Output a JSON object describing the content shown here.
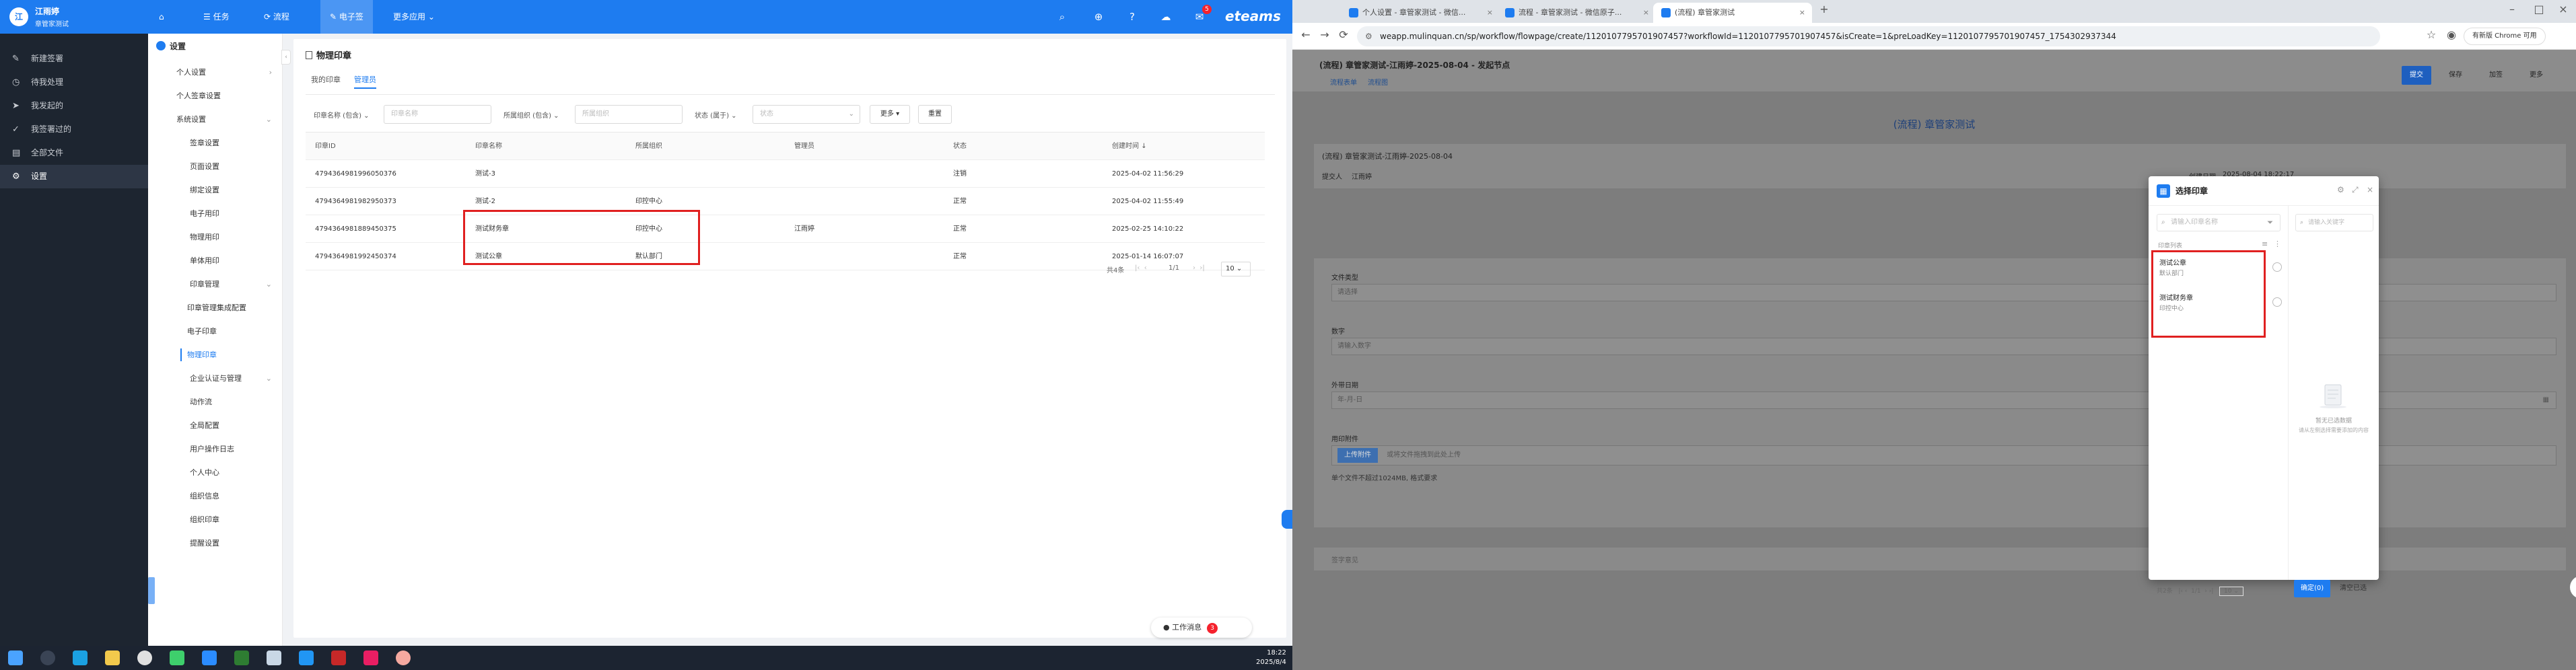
{
  "topbar": {
    "avatar_letter": "江",
    "user_name": "江雨婷",
    "user_sub": "章管家测试",
    "nav": [
      "首页",
      "任务",
      "流程",
      "电子签",
      "更多应用"
    ],
    "badge_count": "5",
    "logo": "eteams"
  },
  "sidebar": {
    "items": [
      "新建签署",
      "待我处理",
      "我发起的",
      "我签署过的",
      "全部文件",
      "设置"
    ]
  },
  "settings_nav": {
    "title": "设置",
    "items": [
      "个人设置",
      "个人签章设置",
      "系统设置",
      "签章设置",
      "页面设置",
      "绑定设置",
      "电子用印",
      "物理用印",
      "单体用印",
      "印章管理",
      "印章管理集成配置",
      "电子印章",
      "物理印章",
      "企业认证与管理",
      "动作流",
      "全局配置",
      "用户操作日志",
      "个人中心",
      "组织信息",
      "组织印章",
      "提醒设置"
    ]
  },
  "main": {
    "page_title": "物理印章",
    "tabs": [
      "我的印章",
      "管理员"
    ],
    "filters": {
      "name_label": "印章名称 (包含)",
      "name_placeholder": "印章名称",
      "org_label": "所属组织 (包含)",
      "org_placeholder": "所属组织",
      "status_label": "状态 (属于)",
      "status_placeholder": "状态",
      "more_btn": "更多",
      "reset_btn": "重置"
    },
    "columns": [
      "印章ID",
      "印章名称",
      "所属组织",
      "管理员",
      "状态",
      "创建时间"
    ],
    "rows": [
      [
        "4794364981996050376",
        "测试-3",
        "",
        "",
        "注销",
        "2025-04-02 11:56:29"
      ],
      [
        "4794364981982950373",
        "测试-2",
        "印控中心",
        "",
        "正常",
        "2025-04-02 11:55:49"
      ],
      [
        "4794364981889450375",
        "测试财务章",
        "印控中心",
        "江雨婷",
        "正常",
        "2025-02-25 14:10:22"
      ],
      [
        "4794364981992450374",
        "测试公章",
        "默认部门",
        "",
        "正常",
        "2025-01-14 16:07:07"
      ]
    ],
    "pager": {
      "total": "共4条",
      "page": "1/1",
      "size": "10"
    },
    "work_notice": "工作消息",
    "work_notice_count": "3"
  },
  "taskbar": {
    "time": "18:22",
    "date": "2025/8/4"
  },
  "browser": {
    "tabs": [
      "个人设置 - 章管家测试 - 微信...",
      "流程 - 章管家测试 - 微信原子...",
      "(流程) 章管家测试"
    ],
    "url": "weapp.mulinquan.cn/sp/workflow/flowpage/create/1120107795701907457?workflowId=1120107795701907457&isCreate=1&preLoadKey=1120107795701907457_1754302937344",
    "update_btn": "有新版 Chrome 可用",
    "page": {
      "title": "(流程) 章管家测试-江雨婷-2025-08-04 - 发起节点",
      "sub_tabs": [
        "流程表单",
        "流程图"
      ],
      "buttons": [
        "提交",
        "保存",
        "加签",
        "更多"
      ],
      "form_title": "(流程) 章管家测试",
      "request_title": "(流程) 章管家测试-江雨婷-2025-08-04",
      "creator_label": "提交人",
      "creator": "江雨婷",
      "date_label": "创建日期",
      "date": "2025-08-04 18:22:17",
      "fields": [
        "文件类型",
        "数字",
        "外带日期",
        "用印附件"
      ],
      "file_type_ph": "请选择",
      "number_ph": "请输入数字",
      "date_ph": "年-月-日",
      "upload_btn": "上传附件",
      "upload_hint": "或将文件拖拽到此处上传",
      "upload_limit": "单个文件不超过1024MB, 格式要求",
      "sign_ph": "签字意见"
    },
    "modal": {
      "title": "选择印章",
      "search_ph": "请输入印章名称",
      "section": "印章列表",
      "options": [
        {
          "name": "测试公章",
          "org": "默认部门"
        },
        {
          "name": "测试财务章",
          "org": "印控中心"
        }
      ],
      "right_search_ph": "请输入关键字",
      "empty_title": "暂无已选数据",
      "empty_hint": "请从左侧选择需要添加的内容",
      "pager_total": "共2条",
      "pager_page": "1/1",
      "pager_size": "10",
      "confirm_btn": "确定(0)",
      "clear_btn": "清空已选"
    }
  }
}
